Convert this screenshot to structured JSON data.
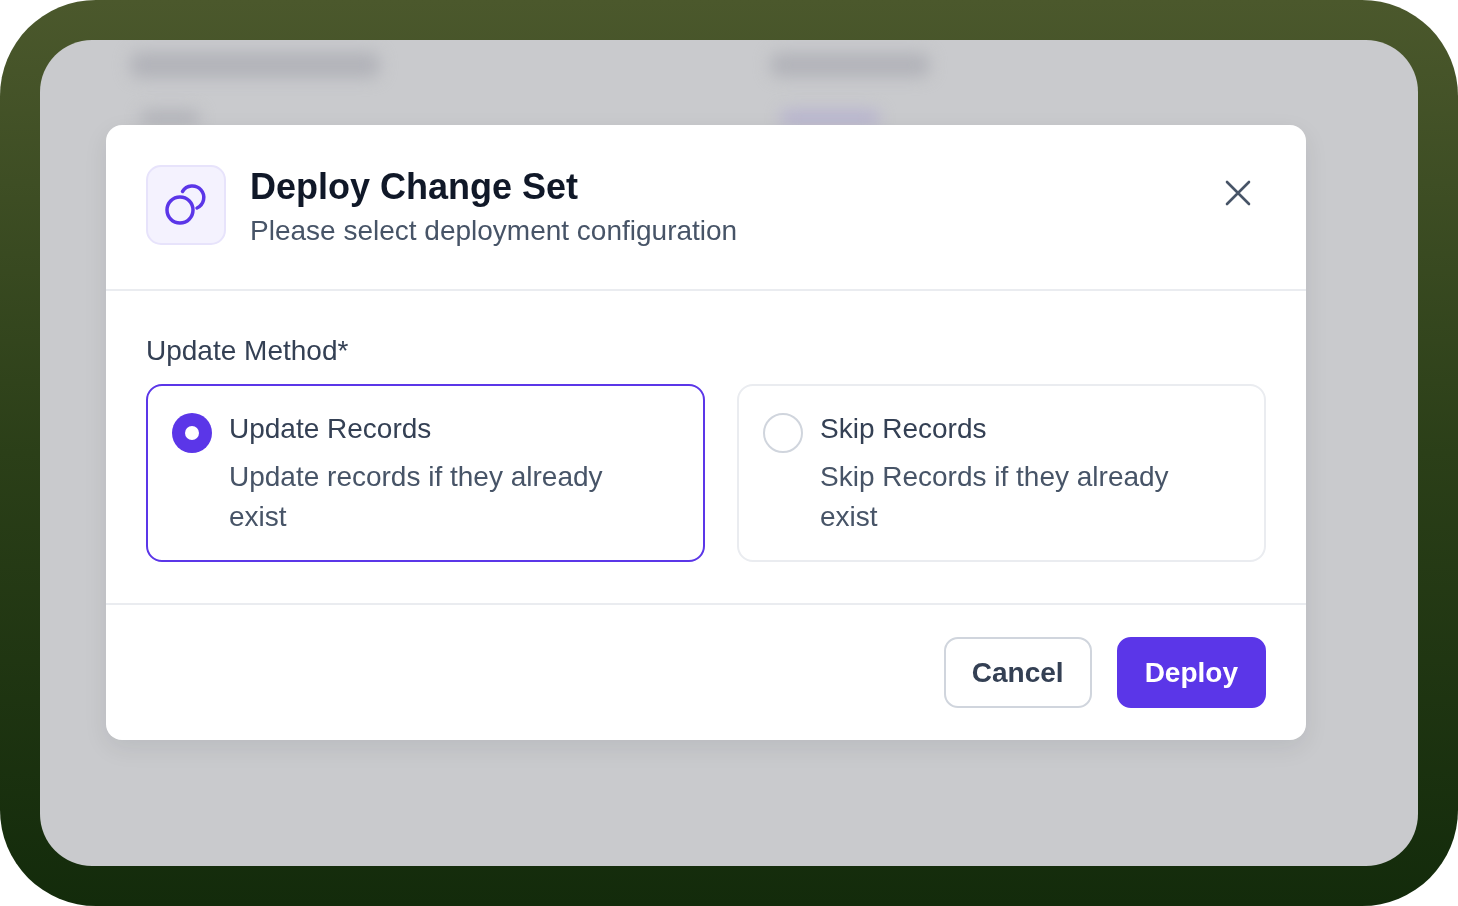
{
  "dialog": {
    "title": "Deploy Change Set",
    "subtitle": "Please select deployment configuration",
    "field_label": "Update Method*",
    "options": [
      {
        "title": "Update Records",
        "description": "Update records if they already exist",
        "selected": true
      },
      {
        "title": "Skip Records",
        "description": "Skip Records if they already exist",
        "selected": false
      }
    ],
    "buttons": [
      {
        "label": "Cancel",
        "kind": "secondary"
      },
      {
        "label": "Deploy",
        "kind": "primary"
      }
    ]
  }
}
